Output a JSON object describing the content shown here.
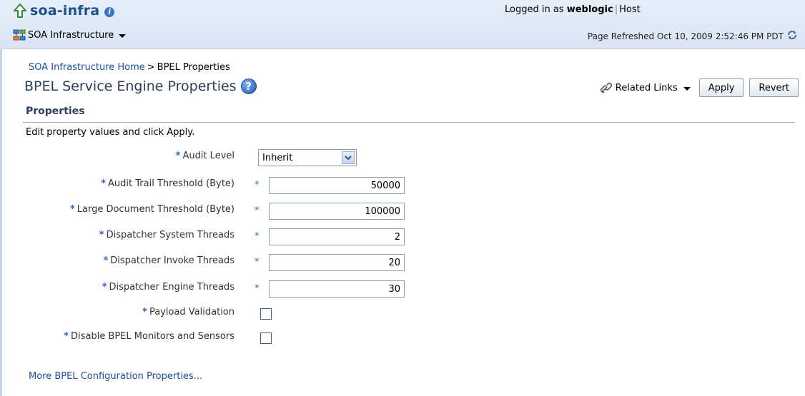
{
  "header": {
    "target_name": "soa-infra",
    "menu_label": "SOA Infrastructure",
    "logged_in_prefix": "Logged in as",
    "user": "weblogic",
    "host_label": "Host",
    "refreshed": "Page Refreshed Oct 10, 2009 2:52:46 PM PDT"
  },
  "breadcrumb": {
    "home": "SOA Infrastructure Home",
    "separator": ">",
    "current": "BPEL Properties"
  },
  "page": {
    "title": "BPEL Service Engine Properties",
    "help_glyph": "?",
    "related_links": "Related Links",
    "apply": "Apply",
    "revert": "Revert"
  },
  "properties": {
    "section_title": "Properties",
    "instruction": "Edit property values and click Apply.",
    "required_marker": "*",
    "audit_level": {
      "label": "Audit Level",
      "value": "Inherit"
    },
    "fields": [
      {
        "label": "Audit Trail Threshold (Byte)",
        "value": "50000"
      },
      {
        "label": "Large Document Threshold (Byte)",
        "value": "100000"
      },
      {
        "label": "Dispatcher System Threads",
        "value": "2"
      },
      {
        "label": "Dispatcher Invoke Threads",
        "value": "20"
      },
      {
        "label": "Dispatcher Engine Threads",
        "value": "30"
      }
    ],
    "checkboxes": [
      {
        "label": "Payload Validation",
        "checked": false
      },
      {
        "label": "Disable BPEL Monitors and Sensors",
        "checked": false
      }
    ]
  },
  "more_link": "More BPEL Configuration Properties...",
  "colors": {
    "link": "#1a4fa0",
    "title": "#2b3f5c",
    "required": "#2f62b8",
    "header_bg": "#dfe8f6"
  }
}
